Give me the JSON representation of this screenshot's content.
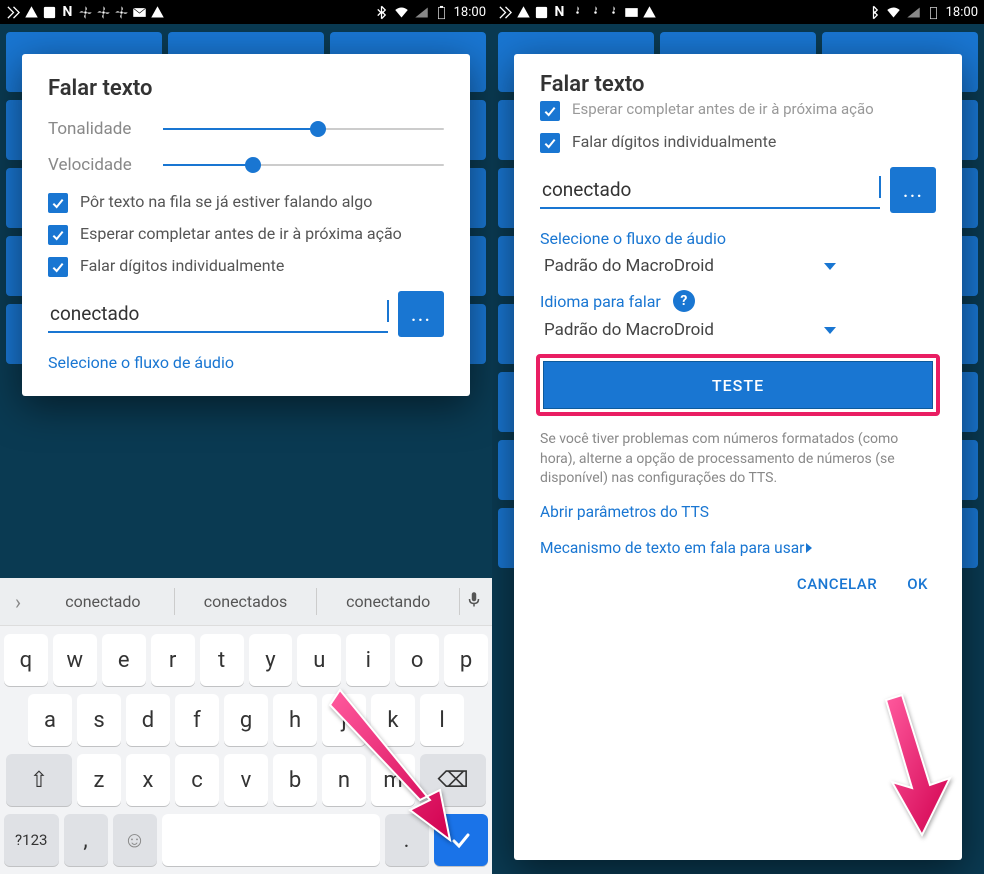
{
  "statusbar": {
    "time": "18:00",
    "icons_left": [
      "app",
      "warning",
      "image",
      "N",
      "fan",
      "fan",
      "fan",
      "mail",
      "warning"
    ],
    "icons_right": [
      "bluetooth",
      "wifi",
      "signal",
      "battery"
    ]
  },
  "left": {
    "title": "Falar texto",
    "slider1_label": "Tonalidade",
    "slider1_value": 55,
    "slider2_label": "Velocidade",
    "slider2_value": 32,
    "check1": "Pôr texto na fila se já estiver falando algo",
    "check2": "Esperar completar antes de ir à próxima ação",
    "check3": "Falar dígitos individualmente",
    "input_value": "conectado",
    "more_btn": "...",
    "section_link": "Selecione o fluxo de áudio",
    "suggestions": [
      "conectado",
      "conectados",
      "conectando"
    ],
    "keys_row1": [
      "q",
      "w",
      "e",
      "r",
      "t",
      "y",
      "u",
      "i",
      "o",
      "p"
    ],
    "keys_row2": [
      "a",
      "s",
      "d",
      "f",
      "g",
      "h",
      "j",
      "k",
      "l"
    ],
    "keys_row3_shift": "⇧",
    "keys_row3": [
      "z",
      "x",
      "c",
      "v",
      "b",
      "n",
      "m"
    ],
    "keys_row3_del": "⌫",
    "keys_row4_sym": "?123",
    "keys_row4_comma": ",",
    "keys_row4_emoji": "☺",
    "keys_row4_period": ".",
    "keys_row4_enter": "✓"
  },
  "right": {
    "title": "Falar texto",
    "check1": "Esperar completar antes de ir à próxima ação",
    "check2": "Falar dígitos individualmente",
    "input_value": "conectado",
    "more_btn": "...",
    "section1_label": "Selecione o fluxo de áudio",
    "select1_value": "Padrão do MacroDroid",
    "section2_label": "Idioma para falar",
    "select2_value": "Padrão do MacroDroid",
    "teste_btn": "TESTE",
    "info_text": "Se você tiver problemas com números formatados (como hora), alterne a opção de processamento de números (se disponível) nas configurações do TTS.",
    "link1": "Abrir parâmetros do TTS",
    "link2": "Mecanismo de texto em fala para usar",
    "cancel": "CANCELAR",
    "ok": "OK"
  }
}
